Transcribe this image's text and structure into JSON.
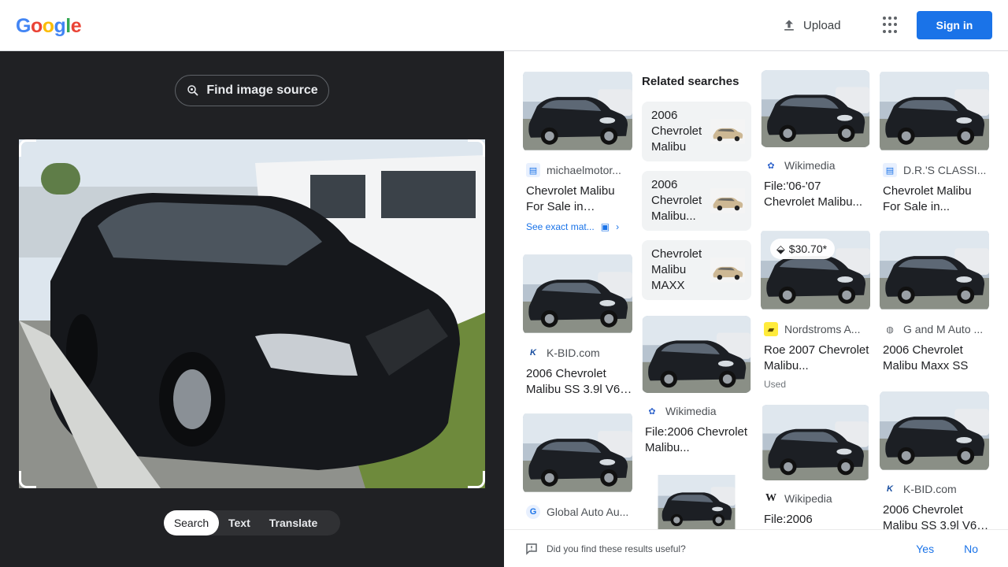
{
  "header": {
    "logo_letters": [
      "G",
      "o",
      "o",
      "g",
      "l",
      "e"
    ],
    "upload_label": "Upload",
    "apps_icon": "apps-grid-icon",
    "signin_label": "Sign in"
  },
  "left": {
    "find_source_label": "Find image source",
    "modes": [
      "Search",
      "Text",
      "Translate"
    ],
    "active_mode": "Search"
  },
  "results": {
    "col1": [
      {
        "source": "michaelmotor...",
        "title": "Chevrolet Malibu For Sale in Harvey...",
        "exact_label": "See exact mat..."
      },
      {
        "source": "K-BID.com",
        "title": "2006 Chevrolet Malibu SS 3.9l V6 ..."
      },
      {
        "source": "Global Auto Au...",
        "title": ""
      }
    ],
    "related_heading": "Related searches",
    "related": [
      "2006 Chevrolet Malibu",
      "2006 Chevrolet Malibu...",
      "Chevrolet Malibu MAXX"
    ],
    "col2": [
      {
        "source": "Wikimedia",
        "title": "File:2006 Chevrolet Malibu..."
      }
    ],
    "col3": [
      {
        "source": "Wikimedia",
        "title": "File:'06-'07 Chevrolet Malibu..."
      },
      {
        "source": "Nordstroms A...",
        "title": "Roe 2007 Chevrolet Malibu...",
        "note": "Used",
        "price": "$30.70*"
      },
      {
        "source": "Wikipedia",
        "title": "File:2006"
      }
    ],
    "col4": [
      {
        "source": "D.R.'S CLASSI...",
        "title": "Chevrolet Malibu For Sale in..."
      },
      {
        "source": "G and M Auto ...",
        "title": "2006 Chevrolet Malibu Maxx SS"
      },
      {
        "source": "K-BID.com",
        "title": "2006 Chevrolet Malibu SS 3.9l V6 ..."
      }
    ]
  },
  "feedback": {
    "question": "Did you find these results useful?",
    "yes": "Yes",
    "no": "No"
  }
}
